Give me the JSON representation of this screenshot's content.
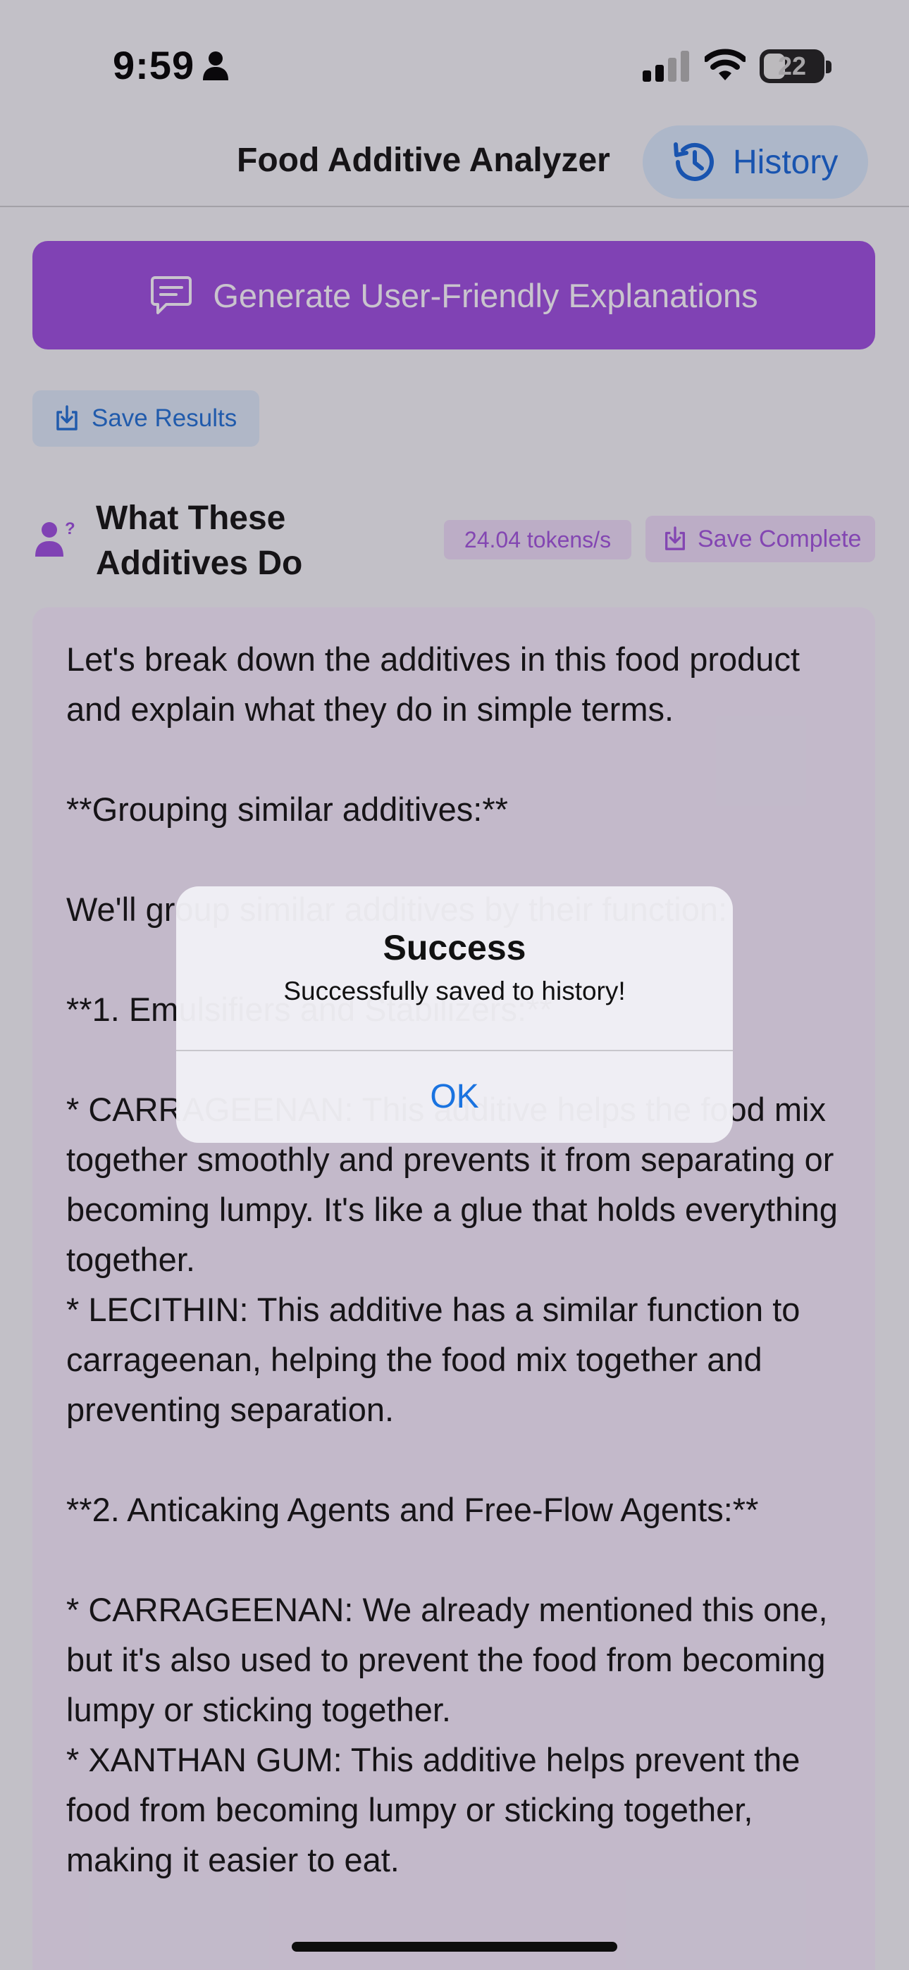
{
  "status_bar": {
    "time": "9:59",
    "battery": "22"
  },
  "nav": {
    "title": "Food Additive Analyzer",
    "history_label": "History"
  },
  "actions": {
    "generate_label": "Generate User-Friendly Explanations",
    "save_results_label": "Save Results"
  },
  "section": {
    "title": "What These Additives Do",
    "tokens_rate": "24.04 tokens/s",
    "save_complete_label": "Save Complete"
  },
  "explanation": {
    "text": "Let's break down the additives in this food product and explain what they do in simple terms.\n\n**Grouping similar additives:**\n\nWe'll group similar additives by their function:\n\n**1. Emulsifiers and Stabilizers:**\n\n* CARRAGEENAN: This additive helps the food mix together smoothly and prevents it from separating or becoming lumpy. It's like a glue that holds everything together.\n* LECITHIN: This additive has a similar function to carrageenan, helping the food mix together and preventing separation.\n\n**2. Anticaking Agents and Free-Flow Agents:**\n\n* CARRAGEENAN: We already mentioned this one, but it's also used to prevent the food from becoming lumpy or sticking together.\n* XANTHAN GUM: This additive helps prevent the food from becoming lumpy or sticking together, making it easier to eat."
  },
  "alert": {
    "title": "Success",
    "message": "Successfully saved to history!",
    "ok_label": "OK"
  },
  "icons": {
    "person": "person-icon",
    "signal": "cellular-signal-icon",
    "wifi": "wifi-icon",
    "history": "clock-history-icon",
    "chat": "chat-bubble-icon",
    "save": "download-save-icon",
    "user_question": "user-question-icon"
  },
  "colors": {
    "accent_purple": "#9c4ddf",
    "accent_blue": "#1565d8",
    "box_background": "#f3e9fb"
  }
}
